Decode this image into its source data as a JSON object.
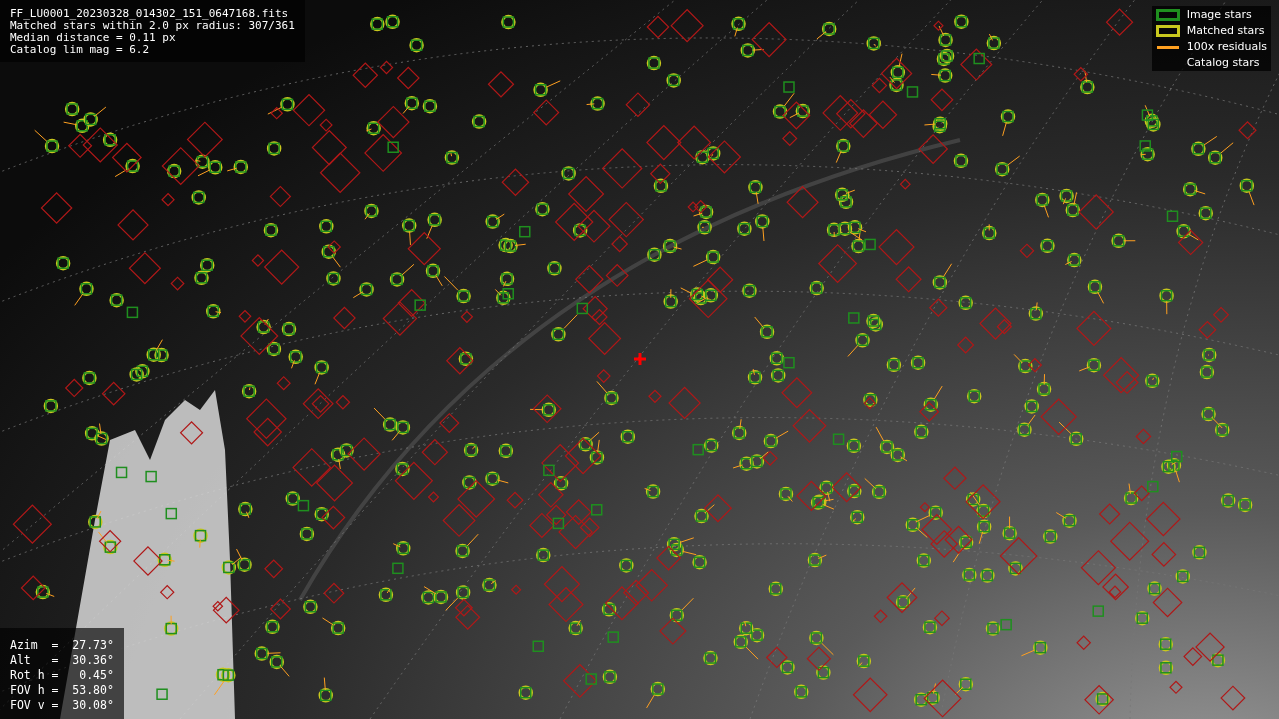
{
  "header": {
    "lines": [
      "FF_LU0001_20230328_014302_151_0647168.fits",
      "Matched stars within 2.0 px radius: 307/361",
      "Median distance = 0.11 px",
      "Catalog lim mag = 6.2"
    ]
  },
  "legend": [
    {
      "kind": "rect",
      "color": "#1f8f1f",
      "label": "Image stars"
    },
    {
      "kind": "rect",
      "color": "#c8c81e",
      "label": "Matched stars"
    },
    {
      "kind": "line",
      "color": "#ffa020",
      "label": "100x residuals"
    },
    {
      "kind": "blank",
      "label": "Catalog stars"
    }
  ],
  "pointing": {
    "rows": [
      "Azim  =  27.73°",
      "Alt   =  30.36°",
      "Rot h =   0.45°",
      "FOV h =  53.80°",
      "FOV v =  30.08°"
    ]
  }
}
